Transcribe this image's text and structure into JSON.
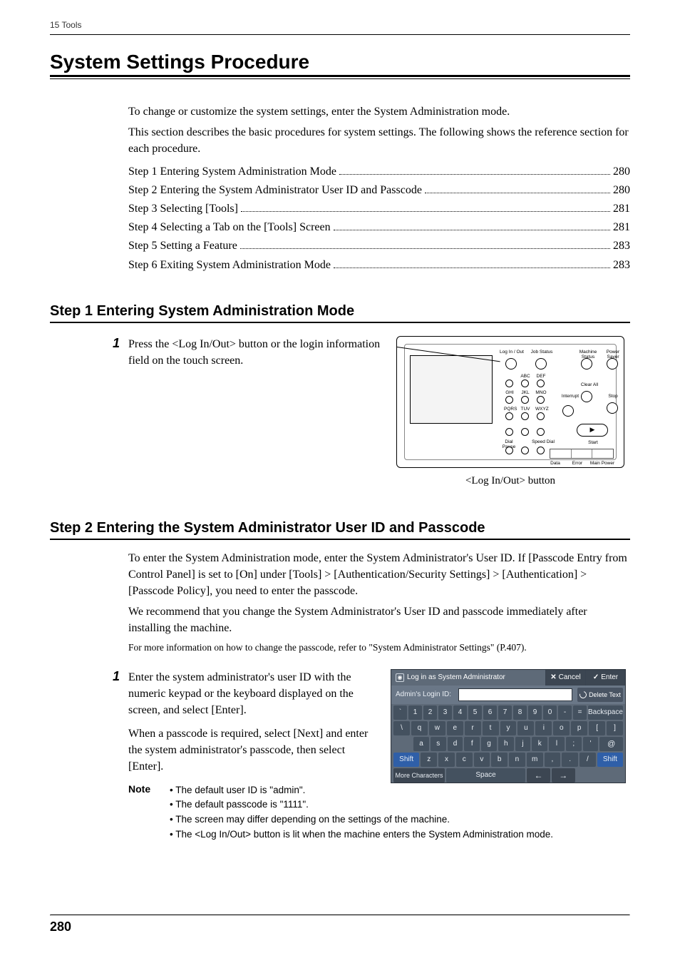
{
  "running_head": "15 Tools",
  "h1": "System Settings Procedure",
  "intro": {
    "p1": "To change or customize the system settings, enter the System Administration mode.",
    "p2": "This section describes the basic procedures for system settings. The following shows the reference section for each procedure."
  },
  "toc": [
    {
      "label": "Step 1 Entering System Administration Mode",
      "page": "280"
    },
    {
      "label": "Step 2 Entering the System Administrator User ID and Passcode",
      "page": "280"
    },
    {
      "label": "Step 3 Selecting [Tools]",
      "page": "281"
    },
    {
      "label": "Step 4 Selecting a Tab on the [Tools] Screen",
      "page": "281"
    },
    {
      "label": "Step 5 Setting a Feature",
      "page": "283"
    },
    {
      "label": "Step 6 Exiting System Administration Mode",
      "page": "283"
    }
  ],
  "step1": {
    "heading": "Step 1 Entering System Administration Mode",
    "num": "1",
    "text": "Press the <Log In/Out> button or the login information field on the touch screen.",
    "caption": "<Log In/Out> button",
    "panel": {
      "labels": {
        "loginout": "Log In / Out",
        "jobstatus": "Job Status",
        "machine": "Machine Status",
        "power": "Power Saver",
        "clearall": "Clear All",
        "interrupt": "Interrupt",
        "stop": "Stop",
        "start": "Start",
        "dialpause": "Dial Pause",
        "speeddial": "Speed Dial",
        "abc": "ABC",
        "def": "DEF",
        "ghi": "GHI",
        "jkl": "JKL",
        "mno": "MNO",
        "pqrs": "PQRS",
        "tuv": "TUV",
        "wxyz": "WXYZ",
        "status": {
          "data": "Data",
          "error": "Error",
          "main": "Main Power"
        }
      }
    }
  },
  "step2": {
    "heading": "Step 2 Entering the System Administrator User ID and Passcode",
    "p1": "To enter the System Administration mode, enter the System Administrator's User ID. If [Passcode Entry from Control Panel] is set to [On] under [Tools] > [Authentication/Security Settings] > [Authentication] > [Passcode Policy], you need to enter the passcode.",
    "p2": "We recommend that you change the System Administrator's User ID and passcode immediately after installing the machine.",
    "ref": "For more information on how to change the passcode, refer to \"System Administrator Settings\" (P.407).",
    "num": "1",
    "stepP1": "Enter the system administrator's user ID with the numeric keypad or the keyboard displayed on the screen, and select [Enter].",
    "stepP2": "When a passcode is required, select [Next] and enter the system administrator's passcode, then select [Enter].",
    "noteLabel": "Note",
    "notes": [
      "The default user ID is \"admin\".",
      "The default passcode is \"1111\".",
      "The screen may differ depending on the settings of the machine.",
      "The <Log In/Out> button is lit when the machine enters the System Administration mode."
    ],
    "kbd": {
      "title": "Log in as System Administrator",
      "cancel": "Cancel",
      "enter": "Enter",
      "idlabel": "Admin's Login ID:",
      "del": "Delete Text",
      "backspace": "Backspace",
      "shift": "Shift",
      "space": "Space",
      "more": "More Characters",
      "left": "←",
      "right": "→",
      "x_sym": "✕",
      "check": "✓",
      "rows": {
        "r1": [
          "`",
          "1",
          "2",
          "3",
          "4",
          "5",
          "6",
          "7",
          "8",
          "9",
          "0",
          "-",
          "="
        ],
        "r2": [
          "\\",
          "q",
          "w",
          "e",
          "r",
          "t",
          "y",
          "u",
          "i",
          "o",
          "p",
          "[",
          "]"
        ],
        "r3": [
          "a",
          "s",
          "d",
          "f",
          "g",
          "h",
          "j",
          "k",
          "l",
          ";",
          "'",
          "@"
        ],
        "r4": [
          "z",
          "x",
          "c",
          "v",
          "b",
          "n",
          "m",
          ",",
          ".",
          "/"
        ]
      }
    }
  },
  "page_number": "280"
}
